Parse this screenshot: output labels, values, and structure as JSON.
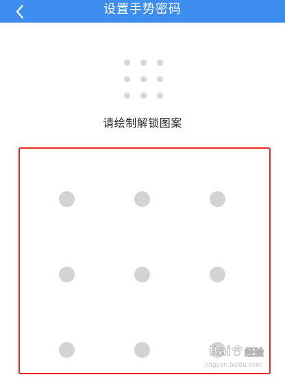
{
  "header": {
    "title": "设置手势密码",
    "back_icon": "chevron-left-icon",
    "background_color": "#3d8cf0"
  },
  "preview": {
    "rows": 3,
    "cols": 3,
    "dot_color": "#d7d7d7"
  },
  "prompt": {
    "text": "请绘制解锁图案"
  },
  "pattern_grid": {
    "rows": 3,
    "cols": 3,
    "node_color": "#d3d3d3",
    "highlight_border_color": "#e8251f"
  },
  "watermark": {
    "brand": "Bai",
    "brand_suffix": "经验",
    "url": "jingyan.baidu.com"
  }
}
